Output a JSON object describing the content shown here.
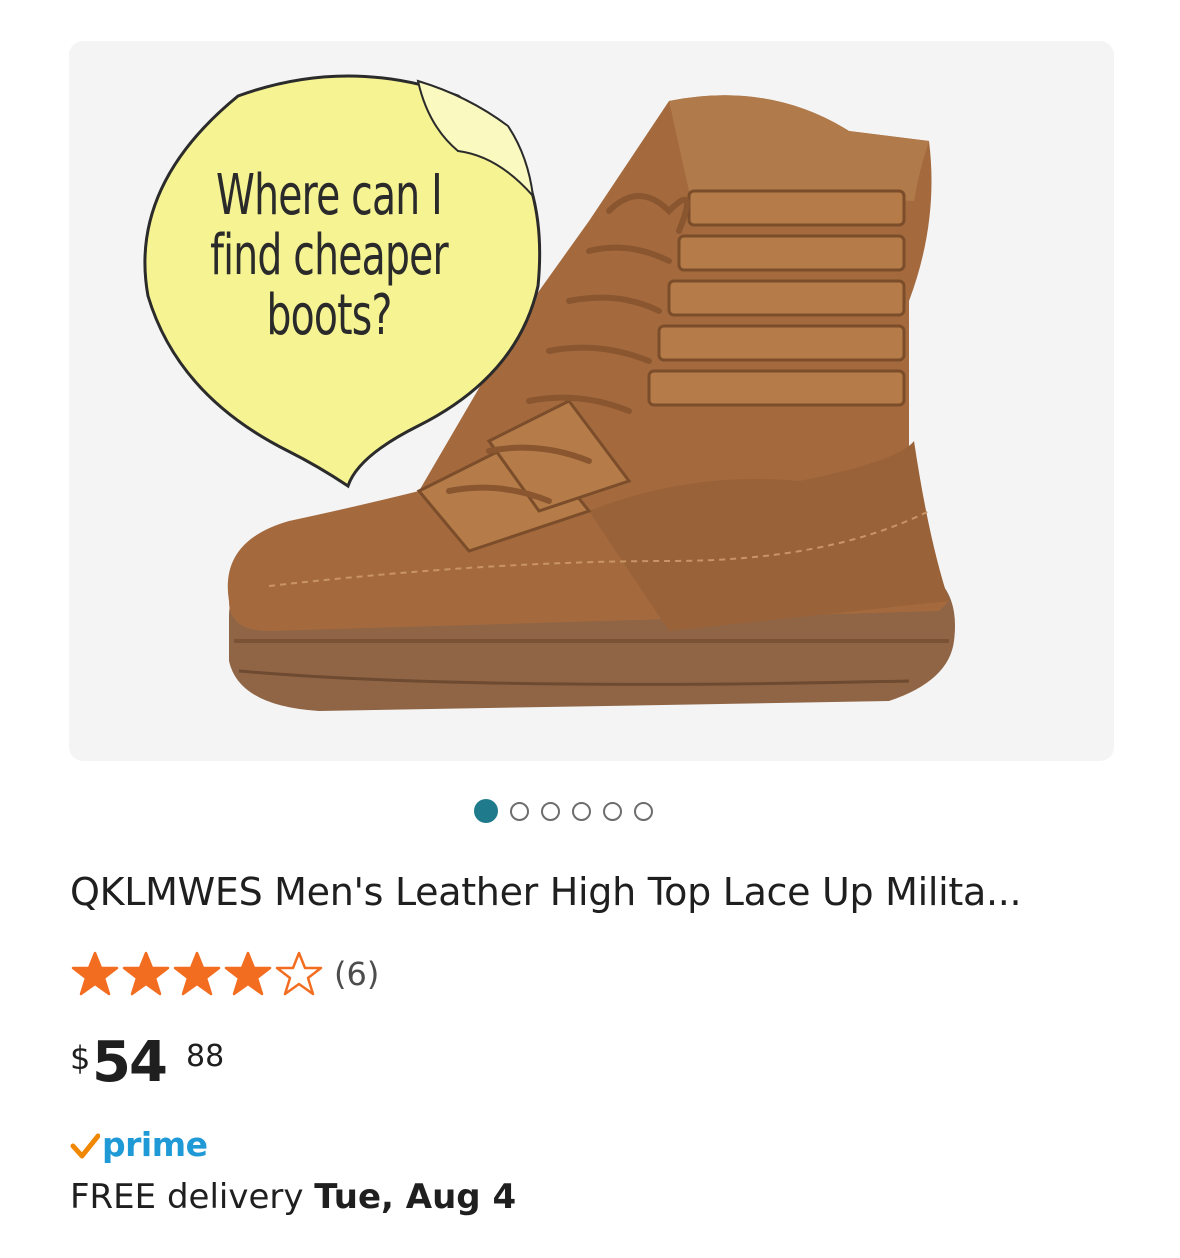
{
  "product_image": {
    "sticky_note_lines": [
      "Where can I",
      "find cheaper",
      "boots?"
    ],
    "background_color": "#f4f4f4",
    "boot_color": "#a0683f"
  },
  "carousel": {
    "total": 6,
    "active_index": 0,
    "active_color": "#1f7a8c"
  },
  "product": {
    "title": "QKLMWES Men's Leather High Top Lace Up Milita...",
    "rating": 4,
    "rating_max": 5,
    "review_count": "(6)",
    "star_color": "#f36d21",
    "price_symbol": "$",
    "price_whole": "54",
    "price_fraction": "88"
  },
  "shipping": {
    "prime_label": "prime",
    "prime_color": "#1f9ad6",
    "check_color": "#f08804",
    "delivery_prefix": "FREE delivery ",
    "delivery_date": "Tue, Aug 4"
  }
}
